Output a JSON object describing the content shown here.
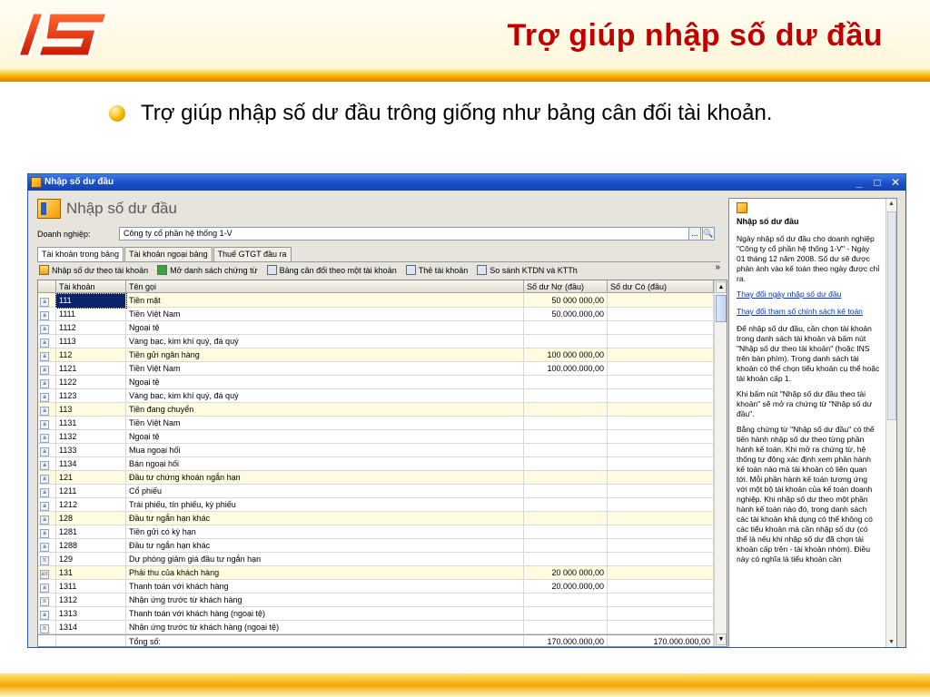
{
  "slide": {
    "title": "Trợ giúp nhập số dư đầu",
    "bullet": "Trợ giúp nhập số dư đầu trông giống như bảng cân đối tài khoản."
  },
  "window": {
    "title": "Nhập số dư đầu",
    "header_title": "Nhập số dư đầu",
    "controls": {
      "minimize": "_",
      "maximize": "□",
      "close": "✕"
    }
  },
  "company": {
    "label": "Doanh nghiệp:",
    "value": "Công ty cổ phần hệ thống 1-V",
    "browse": "...",
    "search": "🔍"
  },
  "tabs": [
    {
      "label": "Tài khoản trong bảng"
    },
    {
      "label": "Tài khoản ngoại bảng"
    },
    {
      "label": "Thuế GTGT đầu ra"
    }
  ],
  "toolbar": [
    {
      "label": "Nhập số dư theo tài khoản",
      "icon": "import-icon"
    },
    {
      "label": "Mở danh sách chứng từ",
      "icon": "open-book-icon"
    },
    {
      "label": "Bảng cân đối theo một tài khoản",
      "icon": "report-icon"
    },
    {
      "label": "Thẻ tài khoản",
      "icon": "report-icon"
    },
    {
      "label": "So sánh KTDN và KTTh",
      "icon": "report-icon"
    }
  ],
  "toolbar_more": "»",
  "grid": {
    "columns": [
      "Tài khoản",
      "Tên gọi",
      "Số dư Nợ (đầu)",
      "Số dư Có (đầu)"
    ],
    "rows": [
      {
        "code": "111",
        "name": "Tiền mặt",
        "debit": "50 000 000,00",
        "credit": "",
        "group": true,
        "mark": "a"
      },
      {
        "code": "1111",
        "name": "Tiền Việt Nam",
        "debit": "50.000.000,00",
        "credit": "",
        "group": false,
        "mark": "a"
      },
      {
        "code": "1112",
        "name": "Ngoại tệ",
        "debit": "",
        "credit": "",
        "group": false,
        "mark": "a"
      },
      {
        "code": "1113",
        "name": "Vàng bạc, kim khí quý, đá quý",
        "debit": "",
        "credit": "",
        "group": false,
        "mark": "a"
      },
      {
        "code": "112",
        "name": "Tiền gửi ngân hàng",
        "debit": "100 000 000,00",
        "credit": "",
        "group": true,
        "mark": "a"
      },
      {
        "code": "1121",
        "name": "Tiền Việt Nam",
        "debit": "100.000.000,00",
        "credit": "",
        "group": false,
        "mark": "a"
      },
      {
        "code": "1122",
        "name": "Ngoại tệ",
        "debit": "",
        "credit": "",
        "group": false,
        "mark": "a"
      },
      {
        "code": "1123",
        "name": "Vàng bạc, kim khí quý, đá quý",
        "debit": "",
        "credit": "",
        "group": false,
        "mark": "a"
      },
      {
        "code": "113",
        "name": "Tiền đang chuyển",
        "debit": "",
        "credit": "",
        "group": true,
        "mark": "a"
      },
      {
        "code": "1131",
        "name": "Tiền Việt Nam",
        "debit": "",
        "credit": "",
        "group": false,
        "mark": "a"
      },
      {
        "code": "1132",
        "name": "Ngoại tệ",
        "debit": "",
        "credit": "",
        "group": false,
        "mark": "a"
      },
      {
        "code": "1133",
        "name": "Mua ngoại hối",
        "debit": "",
        "credit": "",
        "group": false,
        "mark": "a"
      },
      {
        "code": "1134",
        "name": "Bán ngoại hối",
        "debit": "",
        "credit": "",
        "group": false,
        "mark": "a"
      },
      {
        "code": "121",
        "name": "Đầu tư chứng khoán ngắn hạn",
        "debit": "",
        "credit": "",
        "group": true,
        "mark": "a"
      },
      {
        "code": "1211",
        "name": "Cổ phiếu",
        "debit": "",
        "credit": "",
        "group": false,
        "mark": "a"
      },
      {
        "code": "1212",
        "name": "Trái phiếu, tín phiếu, kỳ phiếu",
        "debit": "",
        "credit": "",
        "group": false,
        "mark": "a"
      },
      {
        "code": "128",
        "name": "Đầu tư ngắn hạn khác",
        "debit": "",
        "credit": "",
        "group": true,
        "mark": "a"
      },
      {
        "code": "1281",
        "name": "Tiền gửi có kỳ hạn",
        "debit": "",
        "credit": "",
        "group": false,
        "mark": "a"
      },
      {
        "code": "1288",
        "name": "Đầu tư ngắn hạn khác",
        "debit": "",
        "credit": "",
        "group": false,
        "mark": "a"
      },
      {
        "code": "129",
        "name": "Dự phòng giảm giá đầu tư ngắn hạn",
        "debit": "",
        "credit": "",
        "group": false,
        "mark": "π"
      },
      {
        "code": "131",
        "name": "Phải thu của khách hàng",
        "debit": "20 000 000,00",
        "credit": "",
        "group": true,
        "mark": "aπ"
      },
      {
        "code": "1311",
        "name": "Thanh toán với khách hàng",
        "debit": "20.000.000,00",
        "credit": "",
        "group": false,
        "mark": "a"
      },
      {
        "code": "1312",
        "name": "Nhận ứng trước từ khách hàng",
        "debit": "",
        "credit": "",
        "group": false,
        "mark": "π"
      },
      {
        "code": "1313",
        "name": "Thanh toán với khách hàng (ngoại tệ)",
        "debit": "",
        "credit": "",
        "group": false,
        "mark": "a"
      },
      {
        "code": "1314",
        "name": "Nhận ứng trước từ khách hàng (ngoại tệ)",
        "debit": "",
        "credit": "",
        "group": false,
        "mark": "π"
      }
    ],
    "total": {
      "label": "Tổng số:",
      "debit": "170.000.000,00",
      "credit": "170.000.000,00"
    }
  },
  "help": {
    "title": "Nhập số dư đầu",
    "intro": "Ngày nhập số dư đầu cho doanh nghiệp \"Công ty cổ phần hệ thống 1-V\" - Ngày 01 tháng 12 năm 2008. Số dư sẽ được phản ánh vào kế toán theo ngày được chỉ ra.",
    "link1": "Thay đổi ngày nhập số dư đầu",
    "link2": "Thay đổi tham số chính sách kế toán",
    "p1": "Để nhập số dư đầu, cần chọn tài khoản trong danh sách tài khoản và bấm nút \"Nhập số dư theo tài khoản\" (hoặc INS trên bàn phím). Trong danh sách tài khoản có thể chọn tiểu khoản cụ thể hoặc tài khoản cấp 1.",
    "p2": "Khi bấm nút \"Nhập số dư đầu theo tài khoản\" sẽ mở ra chứng từ \"Nhập số dư đầu\".",
    "p3": "Bằng chứng từ \"Nhập số dư đầu\" có thể tiến hành nhập số dư theo từng phần hành kế toán. Khi mở ra chứng từ, hệ thống tự động xác định xem phần hành kế toán nào mà tài khoản có liên quan tới. Mỗi phần hành kế toán tương ứng với một bộ tài khoản của kế toán doanh nghiệp. Khi nhập số dư theo một phần hành kế toán nào đó, trong danh sách các tài khoản khả dụng có thể không có các tiểu khoản mà cần nhập số dư (có thể là nếu khi nhập số dư đã chọn tài khoản cấp trên - tài khoản nhóm). Điều này có nghĩa là tiểu khoản cần"
  }
}
